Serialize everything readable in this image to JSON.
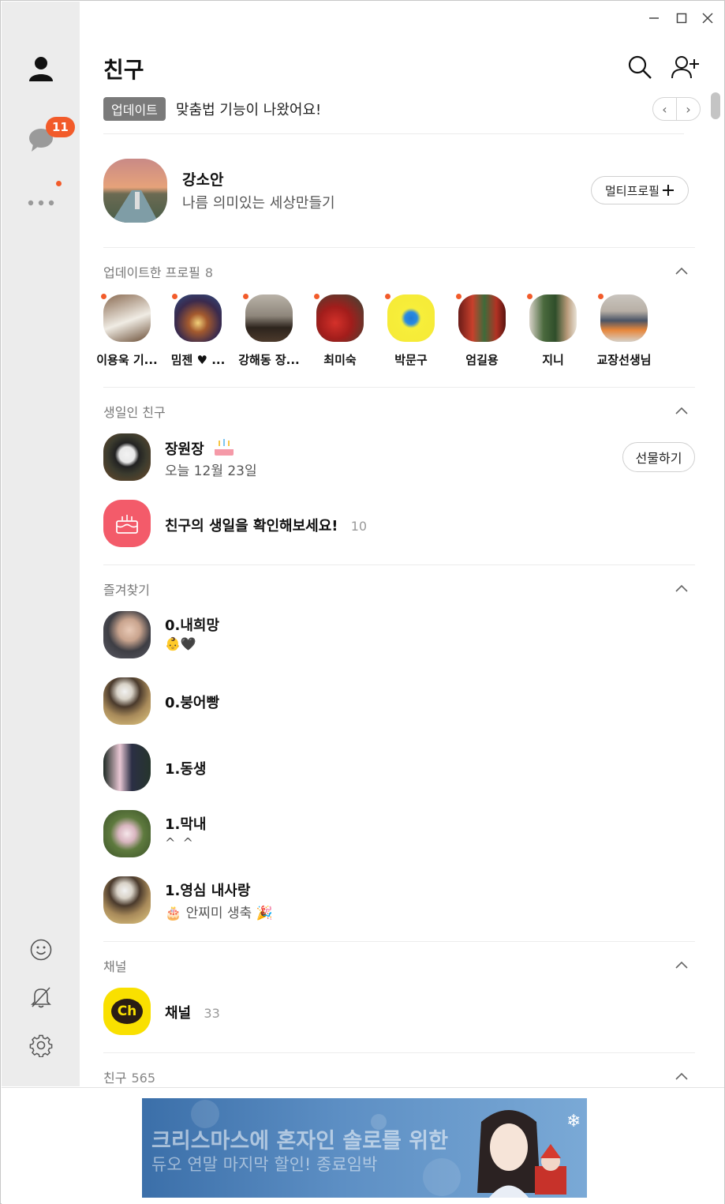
{
  "window": {
    "minimize_icon": "minimize-icon",
    "maximize_icon": "maximize-icon",
    "close_icon": "close-icon"
  },
  "sidebar": {
    "items": [
      {
        "name": "friends",
        "icon": "person-icon"
      },
      {
        "name": "chats",
        "icon": "chat-bubble-icon",
        "badge": "11"
      },
      {
        "name": "more",
        "icon": "more-dots-icon"
      }
    ],
    "bottom": [
      {
        "name": "emoticon",
        "icon": "smile-icon"
      },
      {
        "name": "notifications",
        "icon": "bell-off-icon"
      },
      {
        "name": "settings",
        "icon": "gear-icon"
      }
    ]
  },
  "header": {
    "title": "친구",
    "search_icon": "search-icon",
    "add_friend_icon": "add-friend-icon"
  },
  "update_banner": {
    "badge": "업데이트",
    "text": "맞춤법 기능이 나왔어요!",
    "prev": "‹",
    "next": "›"
  },
  "my_profile": {
    "name": "강소안",
    "status": "나름 의미있는 세상만들기",
    "multi_profile_label": "멀티프로필"
  },
  "updated_profiles": {
    "title": "업데이트한 프로필",
    "count": "8",
    "items": [
      {
        "name": "이용욱 기..."
      },
      {
        "name": "밈젠 ♥ ..."
      },
      {
        "name": "강해동 장..."
      },
      {
        "name": "최미숙"
      },
      {
        "name": "박문구"
      },
      {
        "name": "엄길용"
      },
      {
        "name": "지니"
      },
      {
        "name": "교장선생님"
      }
    ]
  },
  "birthdays": {
    "title": "생일인 친구",
    "friend": {
      "name": "장원장",
      "date": "오늘 12월 23일",
      "gift_label": "선물하기"
    },
    "check": {
      "label": "친구의 생일을 확인해보세요!",
      "count": "10"
    }
  },
  "favorites": {
    "title": "즐겨찾기",
    "items": [
      {
        "name": "0.내희망",
        "status": "👶🖤"
      },
      {
        "name": "0.붕어빵",
        "status": ""
      },
      {
        "name": "1.동생",
        "status": ""
      },
      {
        "name": "1.막내",
        "status": "^ ^"
      },
      {
        "name": "1.영심 내사랑",
        "status": "🎂 안찌미 생축 🎉"
      }
    ]
  },
  "channel": {
    "title": "채널",
    "logo": "Ch",
    "name": "채널",
    "count": "33"
  },
  "friends_section": {
    "title": "친구",
    "count": "565"
  },
  "ad": {
    "line1": "크리스마스에 혼자인 솔로를 위한",
    "line2": "듀오 연말 마지막 할인! 종료임박"
  },
  "colors": {
    "accent": "#f25b2a",
    "channel_yellow": "#f9e000",
    "birthday_red": "#f35b6a"
  }
}
